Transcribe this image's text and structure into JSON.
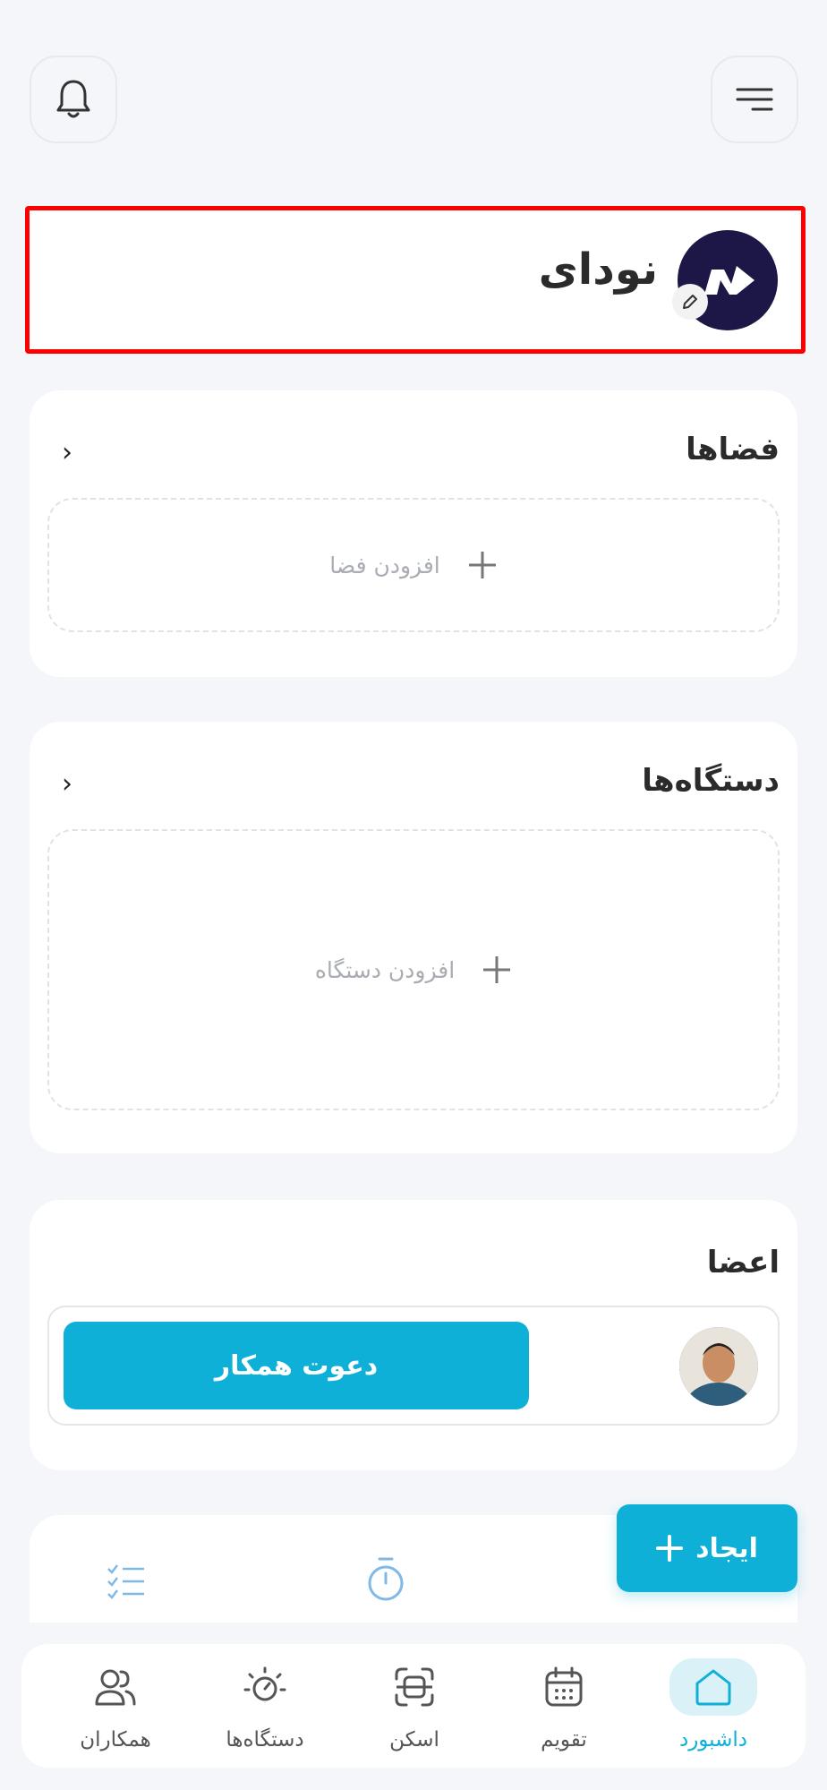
{
  "header": {
    "menu_icon": "menu-icon",
    "bell_icon": "bell-icon"
  },
  "workspace": {
    "name": "نودای",
    "logo_icon": "nodai-logo",
    "edit_icon": "pencil-icon"
  },
  "spaces": {
    "title": "فضاها",
    "add_label": "افزودن فضا"
  },
  "devices": {
    "title": "دستگاه‌ها",
    "add_label": "افزودن دستگاه"
  },
  "members": {
    "title": "اعضا",
    "invite_label": "دعوت همکار"
  },
  "create_button": {
    "label": "ایجاد"
  },
  "bottom_nav": [
    {
      "label": "داشبورد",
      "icon": "home-icon",
      "active": true
    },
    {
      "label": "تقویم",
      "icon": "calendar-icon",
      "active": false
    },
    {
      "label": "اسکن",
      "icon": "scan-icon",
      "active": false
    },
    {
      "label": "دستگاه‌ها",
      "icon": "device-icon",
      "active": false
    },
    {
      "label": "همکاران",
      "icon": "users-icon",
      "active": false
    }
  ],
  "colors": {
    "accent": "#0eb0d8",
    "highlight": "#ff0000",
    "logo_bg": "#1c1747",
    "nav_active_bg": "#d9f1f7"
  }
}
